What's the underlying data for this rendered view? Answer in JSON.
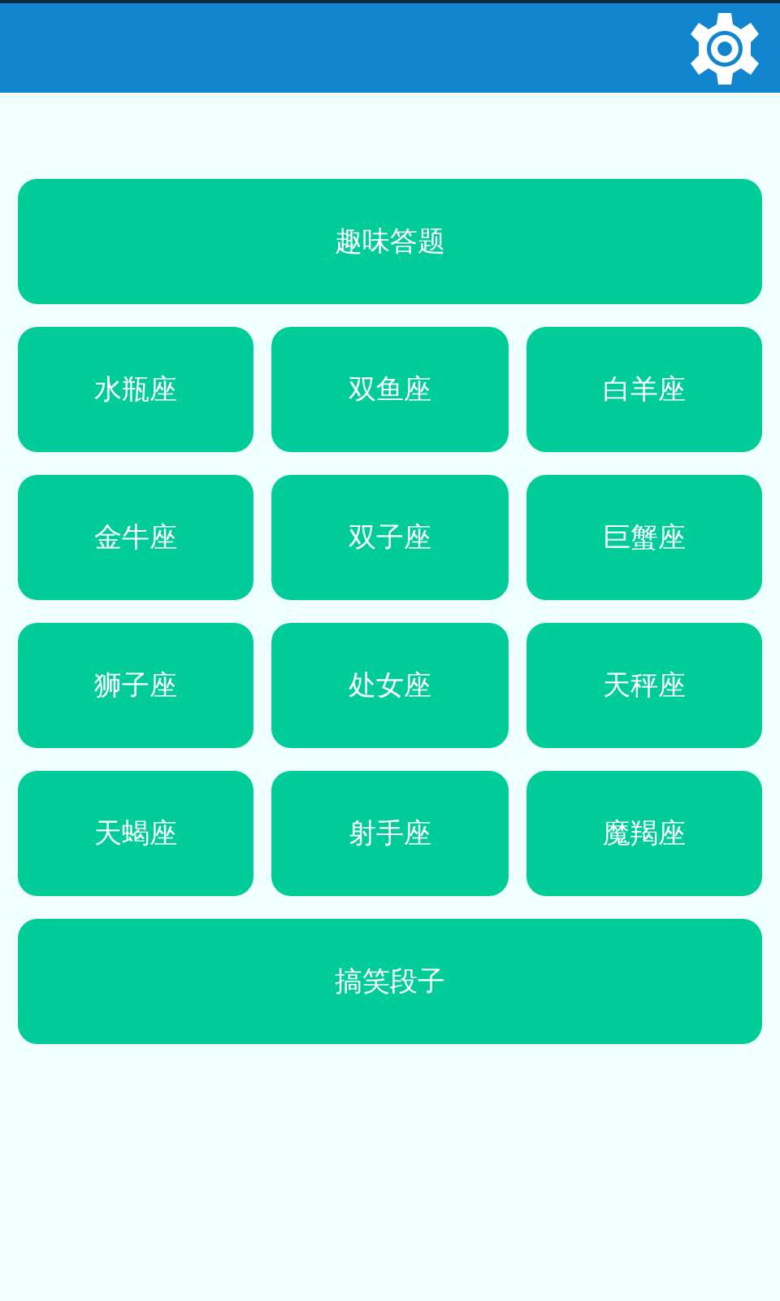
{
  "top_button": "趣味答题",
  "signs": [
    "水瓶座",
    "双鱼座",
    "白羊座",
    "金牛座",
    "双子座",
    "巨蟹座",
    "狮子座",
    "处女座",
    "天秤座",
    "天蝎座",
    "射手座",
    "魔羯座"
  ],
  "bottom_button": "搞笑段子"
}
